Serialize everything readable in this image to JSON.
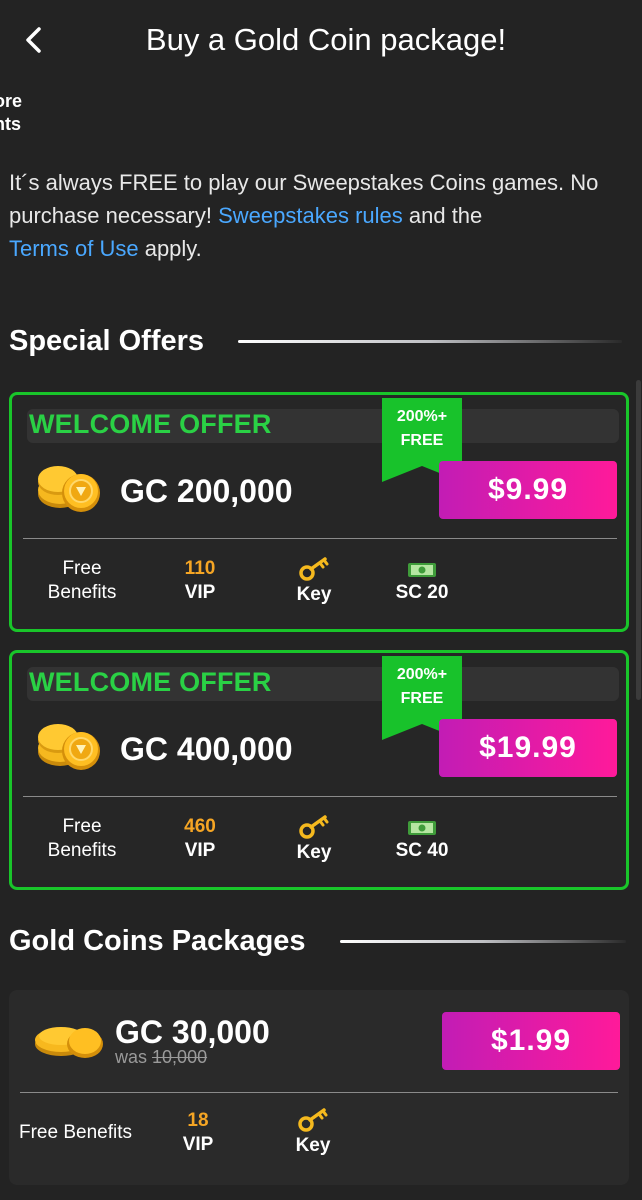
{
  "header": {
    "title": "Buy a Gold Coin package!",
    "back_icon": "chevron-left-icon"
  },
  "cut_text": {
    "line1": "ore",
    "line2": "nts"
  },
  "intro": {
    "part1": "It´s always FREE to play our Sweepstakes Coins games. No purchase necessary! ",
    "link1": "Sweepstakes rules",
    "part2": " and the ",
    "link2": "Terms of Use",
    "part3": " apply."
  },
  "special_offers": {
    "heading": "Special Offers",
    "offers": [
      {
        "label": "WELCOME OFFER",
        "ribbon_line1": "200%+",
        "ribbon_line2": "FREE",
        "amount": "GC 200,000",
        "price": "$9.99",
        "benefits_label": "Free\nBenefits",
        "vip_value": "110",
        "vip_label": "VIP",
        "key_label": "Key",
        "sc_label": "SC 20"
      },
      {
        "label": "WELCOME OFFER",
        "ribbon_line1": "200%+",
        "ribbon_line2": "FREE",
        "amount": "GC 400,000",
        "price": "$19.99",
        "benefits_label": "Free\nBenefits",
        "vip_value": "460",
        "vip_label": "VIP",
        "key_label": "Key",
        "sc_label": "SC 40"
      }
    ]
  },
  "gold_packages": {
    "heading": "Gold Coins Packages",
    "packages": [
      {
        "amount": "GC 30,000",
        "was_label": "was",
        "was_value": "10,000",
        "price": "$1.99",
        "benefits_label": "Free Benefits",
        "vip_value": "18",
        "vip_label": "VIP",
        "key_label": "Key"
      }
    ]
  },
  "colors": {
    "background": "#232323",
    "offer_border": "#19c52a",
    "welcome_text": "#2ad145",
    "price_gradient_start": "#c21cb5",
    "price_gradient_end": "#ff1a9a",
    "vip_number": "#f5a524",
    "link": "#4aa8ff"
  }
}
